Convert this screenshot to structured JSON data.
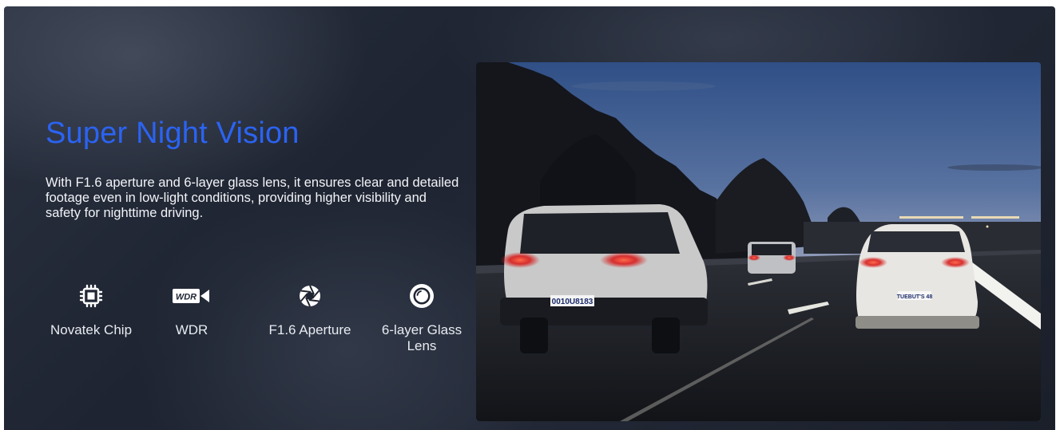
{
  "section": {
    "title": "Super Night Vision",
    "description": "With F1.6 aperture and 6-layer glass lens, it ensures clear and detailed footage even in low-light conditions, providing higher visibility and safety for nighttime driving."
  },
  "features": [
    {
      "label": "Novatek Chip",
      "icon": "chip-icon"
    },
    {
      "label": "WDR",
      "icon": "wdr-camera-icon",
      "icon_text": "WDR"
    },
    {
      "label": "F1.6 Aperture",
      "icon": "aperture-icon"
    },
    {
      "label": "6-layer Glass Lens",
      "icon": "lens-icon"
    }
  ],
  "photo": {
    "plate_left": "0010U8183",
    "plate_right": "TUEBUT'S 48"
  },
  "colors": {
    "accent": "#2b63f2",
    "background": "#1e2431",
    "text": "#f2f4f8"
  }
}
